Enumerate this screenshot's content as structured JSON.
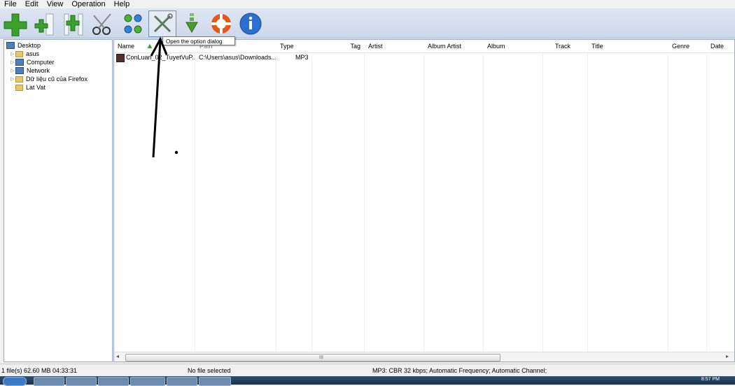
{
  "menu": [
    "File",
    "Edit",
    "View",
    "Operation",
    "Help"
  ],
  "toolbar": {
    "buttons": [
      "add-icon",
      "add-folder-icon",
      "add-split-icon",
      "cut-icon",
      "join-icon",
      "options-icon",
      "download-icon",
      "help-lifebuoy-icon",
      "info-icon"
    ],
    "tooltip": "Open the option dialog"
  },
  "tree": {
    "items": [
      "Desktop",
      "asus",
      "Computer",
      "Network",
      "Dữ liệu cũ của Firefox",
      "Lat Vat"
    ]
  },
  "list": {
    "columns": [
      "Name",
      "Path",
      "Type",
      "Tag",
      "Artist",
      "Album Artist",
      "Album",
      "Track",
      "Title",
      "Genre",
      "Date"
    ],
    "rows": [
      {
        "name": "ConLuan_02_TuyetVuP...",
        "path": "C:\\Users\\asus\\Downloads...",
        "type": "MP3"
      }
    ],
    "scroll_grip": "III"
  },
  "status": {
    "summary": "1 file(s)  62.60 MB  04:33:31",
    "selection": "No file selected",
    "format": "MP3:  CBR  32 kbps; Automatic Frequency; Automatic Channel;"
  },
  "taskbar": {
    "clock": "8:57 PM"
  },
  "colors": {
    "toolbar": "#cdd8ea",
    "add_green": "#3aa02e",
    "info_blue": "#2c6fd0",
    "lifebuoy_red": "#e05a1c"
  }
}
